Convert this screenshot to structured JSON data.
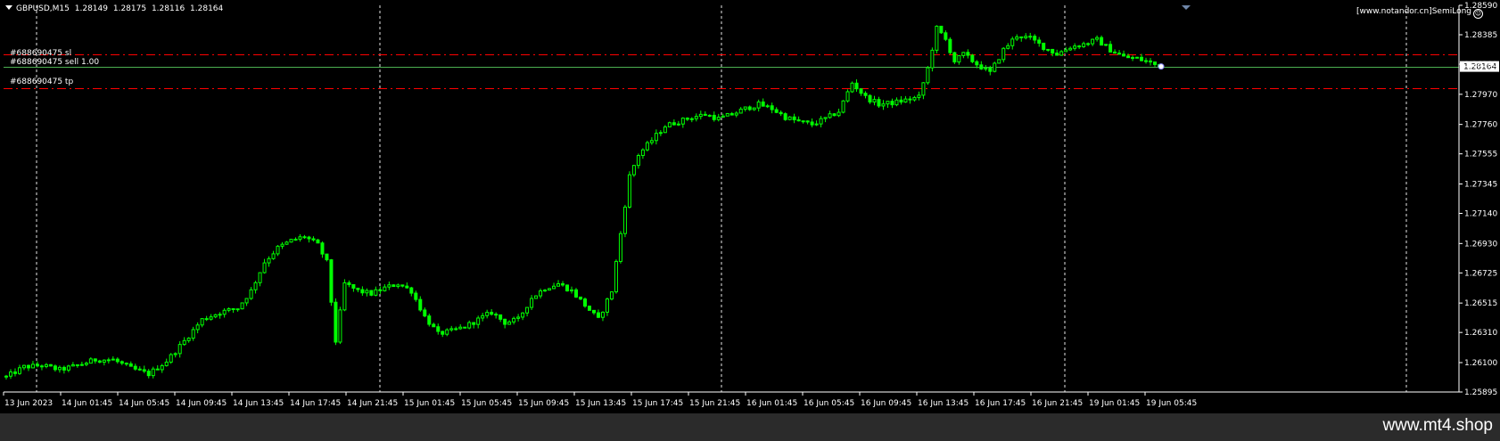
{
  "header": {
    "symbol": "GBPUSD,M15",
    "open": "1.28149",
    "high": "1.28175",
    "low": "1.28116",
    "close": "1.28164"
  },
  "watermark": "[www.notandor.cn]SemiLong",
  "footer": {
    "site": "www.mt4.shop"
  },
  "colors": {
    "background": "#000000",
    "candle": "#00ff00",
    "grid": "#ffffff",
    "level": "#ff0000",
    "bid_line": "#4caf50",
    "footer_bg": "#2b2b2b"
  },
  "chart_data": {
    "type": "candlestick",
    "ylim": [
      1.25895,
      1.2859
    ],
    "y_ticks": [
      "1.28590",
      "1.28385",
      "1.28180",
      "1.27970",
      "1.27760",
      "1.27555",
      "1.27345",
      "1.27140",
      "1.26930",
      "1.26725",
      "1.26515",
      "1.26310",
      "1.26100",
      "1.25895"
    ],
    "x_ticks": [
      "13 Jun 2023",
      "14 Jun 01:45",
      "14 Jun 05:45",
      "14 Jun 09:45",
      "14 Jun 13:45",
      "14 Jun 17:45",
      "14 Jun 21:45",
      "15 Jun 01:45",
      "15 Jun 05:45",
      "15 Jun 09:45",
      "15 Jun 13:45",
      "15 Jun 17:45",
      "15 Jun 21:45",
      "16 Jun 01:45",
      "16 Jun 05:45",
      "16 Jun 09:45",
      "16 Jun 13:45",
      "16 Jun 17:45",
      "16 Jun 21:45",
      "19 Jun 01:45",
      "19 Jun 05:45"
    ],
    "day_separators": [
      "14 Jun 2023",
      "15 Jun 2023",
      "16 Jun 2023",
      "19 Jun 2023",
      "20 Jun 2023"
    ],
    "current_price": "1.28164",
    "levels": [
      {
        "label": "#688690475 sl",
        "price": 1.2825,
        "style": "dashdot"
      },
      {
        "label": "#688690475 sell 1.00",
        "price": 1.28164,
        "style": "solid"
      },
      {
        "label": "#688690475 tp",
        "price": 1.2801,
        "style": "dashdot"
      }
    ],
    "close_path": [
      [
        0,
        1.26
      ],
      [
        4,
        1.2607
      ],
      [
        8,
        1.2608
      ],
      [
        12,
        1.2605
      ],
      [
        16,
        1.2608
      ],
      [
        20,
        1.2612
      ],
      [
        24,
        1.2612
      ],
      [
        28,
        1.2606
      ],
      [
        32,
        1.2602
      ],
      [
        36,
        1.2611
      ],
      [
        40,
        1.2625
      ],
      [
        44,
        1.264
      ],
      [
        48,
        1.2645
      ],
      [
        52,
        1.2648
      ],
      [
        55,
        1.266
      ],
      [
        58,
        1.268
      ],
      [
        61,
        1.269
      ],
      [
        64,
        1.2695
      ],
      [
        67,
        1.2698
      ],
      [
        70,
        1.2692
      ],
      [
        72,
        1.268
      ],
      [
        74,
        1.2625
      ],
      [
        76,
        1.2665
      ],
      [
        79,
        1.266
      ],
      [
        82,
        1.2658
      ],
      [
        85,
        1.2662
      ],
      [
        88,
        1.2665
      ],
      [
        91,
        1.266
      ],
      [
        94,
        1.2642
      ],
      [
        97,
        1.263
      ],
      [
        100,
        1.2632
      ],
      [
        103,
        1.2635
      ],
      [
        106,
        1.264
      ],
      [
        109,
        1.2645
      ],
      [
        112,
        1.2638
      ],
      [
        115,
        1.264
      ],
      [
        118,
        1.2655
      ],
      [
        121,
        1.2662
      ],
      [
        124,
        1.2665
      ],
      [
        127,
        1.266
      ],
      [
        130,
        1.265
      ],
      [
        133,
        1.264
      ],
      [
        136,
        1.266
      ],
      [
        138,
        1.27
      ],
      [
        140,
        1.274
      ],
      [
        142,
        1.2755
      ],
      [
        145,
        1.2765
      ],
      [
        148,
        1.2775
      ],
      [
        151,
        1.2778
      ],
      [
        154,
        1.2781
      ],
      [
        157,
        1.2783
      ],
      [
        160,
        1.278
      ],
      [
        163,
        1.2783
      ],
      [
        166,
        1.2787
      ],
      [
        169,
        1.279
      ],
      [
        172,
        1.2787
      ],
      [
        175,
        1.2781
      ],
      [
        178,
        1.2778
      ],
      [
        181,
        1.2776
      ],
      [
        184,
        1.278
      ],
      [
        187,
        1.2785
      ],
      [
        190,
        1.2805
      ],
      [
        193,
        1.2795
      ],
      [
        196,
        1.279
      ],
      [
        199,
        1.2791
      ],
      [
        202,
        1.2793
      ],
      [
        205,
        1.2795
      ],
      [
        207,
        1.2815
      ],
      [
        209,
        1.2843
      ],
      [
        211,
        1.2835
      ],
      [
        213,
        1.282
      ],
      [
        215,
        1.2825
      ],
      [
        218,
        1.2818
      ],
      [
        221,
        1.2812
      ],
      [
        224,
        1.2828
      ],
      [
        227,
        1.2838
      ],
      [
        230,
        1.2836
      ],
      [
        233,
        1.283
      ],
      [
        236,
        1.2825
      ],
      [
        239,
        1.283
      ],
      [
        242,
        1.2832
      ],
      [
        245,
        1.2835
      ],
      [
        248,
        1.2828
      ],
      [
        251,
        1.2823
      ],
      [
        254,
        1.2822
      ],
      [
        257,
        1.2819
      ],
      [
        259,
        1.28164
      ]
    ]
  }
}
